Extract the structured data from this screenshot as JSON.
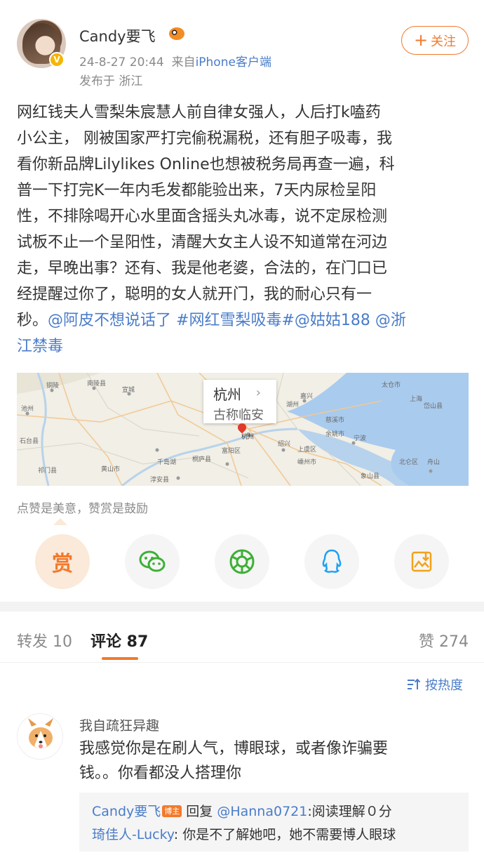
{
  "post": {
    "author": "Candy要飞",
    "verified_badge": "V",
    "timestamp": "24-8-27 20:44",
    "source_prefix": "来自",
    "source": "iPhone客户端",
    "location": "发布于 浙江",
    "follow_label": "关注",
    "follow_plus": "+",
    "text_lines": [
      "网红钱夫人雪梨朱宸慧人前自律女强人，人后打k嗑药",
      "小公主， 刚被国家严打完偷税漏税，还有胆子吸毒，我",
      "看你新品牌Lilylikes Online也想被税务局再查一遍，科",
      "普一下打完K一年内毛发都能验出来，7天内尿检呈阳",
      "性，不排除喝开心水里面含摇头丸冰毒，说不定尿检测",
      "试板不止一个呈阳性，清醒大女主人设不知道常在河边",
      "走，早晚出事？还有、我是他老婆，合法的，在门口已",
      "经提醒过你了，聪明的女人就开门，我的耐心只有一"
    ],
    "text_last_prefix": "秒。",
    "mention1": "@阿皮不想说话了",
    "hashtag": "#网红雪梨吸毒#",
    "mention2": "@姑姑188",
    "mention3_a": "@浙",
    "mention3_b": "江禁毒"
  },
  "map": {
    "city": "杭州",
    "city_sub": "古称临安",
    "chevron": "›",
    "labels": [
      "铜陵",
      "池州",
      "宣城",
      "南陵县",
      "杭州",
      "湖州",
      "嘉兴",
      "上海",
      "绍兴",
      "宁波",
      "舟山",
      "黄山市",
      "千岛湖",
      "富阳区",
      "桐庐县",
      "余姚市",
      "慈溪市",
      "嵊州市",
      "上虞区",
      "象山县",
      "石台县",
      "祁门县",
      "北仑区",
      "淳安县",
      "岱山县",
      "太仓市"
    ]
  },
  "reward_tip": "点赞是美意，赞赏是鼓励",
  "actions": [
    {
      "name": "reward",
      "label": "赏",
      "icon": "reward-icon"
    },
    {
      "name": "wechat",
      "icon": "wechat-icon"
    },
    {
      "name": "moments",
      "icon": "moments-icon"
    },
    {
      "name": "qq",
      "icon": "qq-icon"
    },
    {
      "name": "save-image",
      "icon": "save-image-icon"
    }
  ],
  "tabs": {
    "repost": "转发 10",
    "comment": "评论 87",
    "like": "赞 274"
  },
  "sort_label": "按热度",
  "comments": [
    {
      "user": "我自疏狂异趣",
      "text_lines": [
        "我感觉你是在刷人气，博眼球，或者像诈骗要",
        "钱。。你看都没人搭理你"
      ],
      "replies": [
        {
          "user": "Candy要飞",
          "badge": "博主",
          "verb": "回复",
          "target": "@Hanna0721",
          "text": ":阅读理解０分"
        },
        {
          "user": "琦佳人-Lucky",
          "text": ": 你是不了解她吧，她不需要博人眼球"
        }
      ]
    }
  ],
  "colors": {
    "accent": "#f27a2c",
    "link": "#4a7cc9",
    "muted": "#8a8a8a",
    "verified": "#f7b500"
  }
}
